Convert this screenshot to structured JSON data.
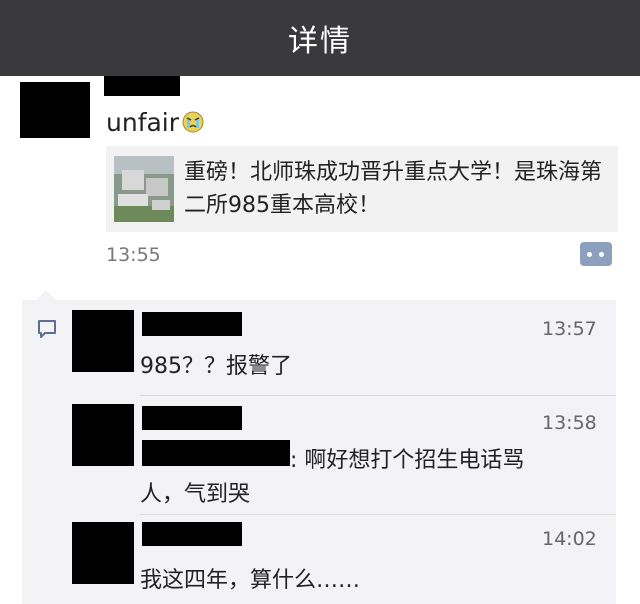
{
  "header": {
    "title": "详情"
  },
  "post": {
    "text": "unfair",
    "emoji": "angry-cry-emoji",
    "link_title": "重磅！北师珠成功晋升重点大学！是珠海第二所985重本高校！",
    "time": "13:55"
  },
  "comments": [
    {
      "time": "13:57",
      "text": "985？？报警了"
    },
    {
      "time": "13:58",
      "text_line1": ": 啊好想打个招生电话骂",
      "text_line2": "人，气到哭"
    },
    {
      "time": "14:02",
      "text": "我这四年，算什么……"
    }
  ],
  "colors": {
    "titlebar": "#3a3a3c",
    "comment_bg": "#f3f3f5",
    "link_card_bg": "#f2f2f2",
    "more_button": "#8c9fbe"
  }
}
